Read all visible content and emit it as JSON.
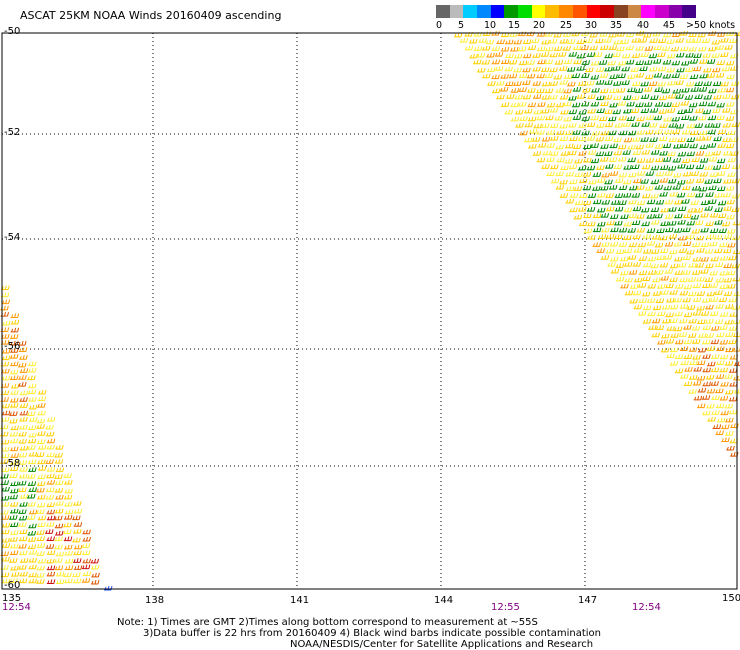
{
  "title": "ASCAT 25KM NOAA Winds 20160409 ascending",
  "colorbar": {
    "labels": [
      "0",
      "5",
      "10",
      "15",
      "20",
      "25",
      "30",
      "35",
      "40",
      "45",
      ">50 knots"
    ],
    "colors": [
      "#666666",
      "#bbbbbb",
      "#00ccff",
      "#0088ff",
      "#0000ff",
      "#009900",
      "#00dd00",
      "#ffff00",
      "#ffbb00",
      "#ff8800",
      "#ff5500",
      "#ff0000",
      "#cc0000",
      "#884422",
      "#cc8844",
      "#ff00ff",
      "#cc00cc",
      "#8800aa",
      "#440088"
    ]
  },
  "axes": {
    "longitudes": [
      "135",
      "138",
      "141",
      "144",
      "147",
      "150"
    ],
    "latitudes": [
      "-50",
      "-52",
      "-54",
      "-56",
      "-58",
      "-60"
    ]
  },
  "pass_times": [
    "12:54",
    "12:55",
    "12:54"
  ],
  "notes": [
    "Note: 1) Times are GMT 2)Times along bottom correspond to measurement at ~55S",
    "3)Data buffer is 22 hrs from 20160409 4) Black wind barbs indicate possible contamination",
    "NOAA/NESDIS/Center for Satellite Applications and Research"
  ],
  "wind_colors": {
    "yellow": "#ffd000",
    "light_yellow": "#ffee33",
    "orange": "#ff9900",
    "dark_orange": "#dd5500",
    "green": "#008800",
    "red": "#cc1111",
    "blue": "#2255ff"
  }
}
